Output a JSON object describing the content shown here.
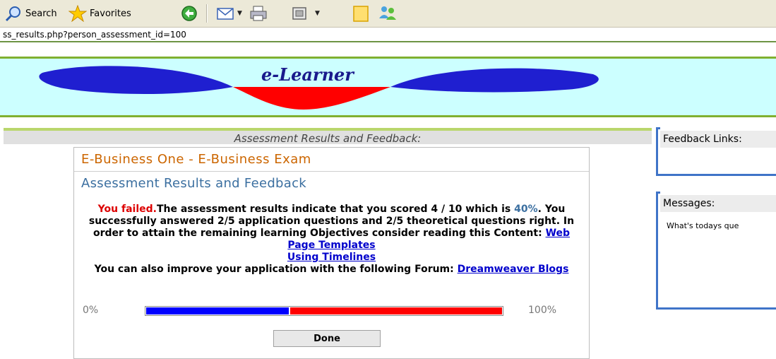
{
  "toolbar": {
    "search_label": "Search",
    "favorites_label": "Favorites"
  },
  "address_bar": {
    "url": "ss_results.php?person_assessment_id=100"
  },
  "header": {
    "logo_text": "e-Learner"
  },
  "section": {
    "title": "Assessment Results and Feedback:"
  },
  "main": {
    "course_title": "E-Business One - E-Business Exam",
    "results_title": "Assessment Results and Feedback",
    "feedback": {
      "failed": "You failed.",
      "text1": "The assessment results indicate that you scored 4 / 10 which is ",
      "percent": "40%",
      "text2": ". You successfully answered 2/5 application questions and 2/5 theoretical questions right. In order to attain the remaining learning Objectives consider reading this Content: ",
      "content_link_1": "Web Page Templates",
      "content_link_2": "Using Timelines",
      "text3": "You can also improve your application with the following Forum: ",
      "forum_link": "Dreamweaver Blogs"
    },
    "progress": {
      "min_label": "0%",
      "max_label": "100%",
      "value": 0.4
    },
    "done_label": "Done"
  },
  "side": {
    "feedback_links_title": "Feedback Links:",
    "messages_title": "Messages:",
    "message_text": "What's todays que"
  },
  "colors": {
    "progress_blue": "#0000ff",
    "progress_red": "#ff0000",
    "fail_red": "#dd0000",
    "course_orange": "#cc6600",
    "heading_blue": "#3b6fa0",
    "header_bg": "#ccffff"
  }
}
